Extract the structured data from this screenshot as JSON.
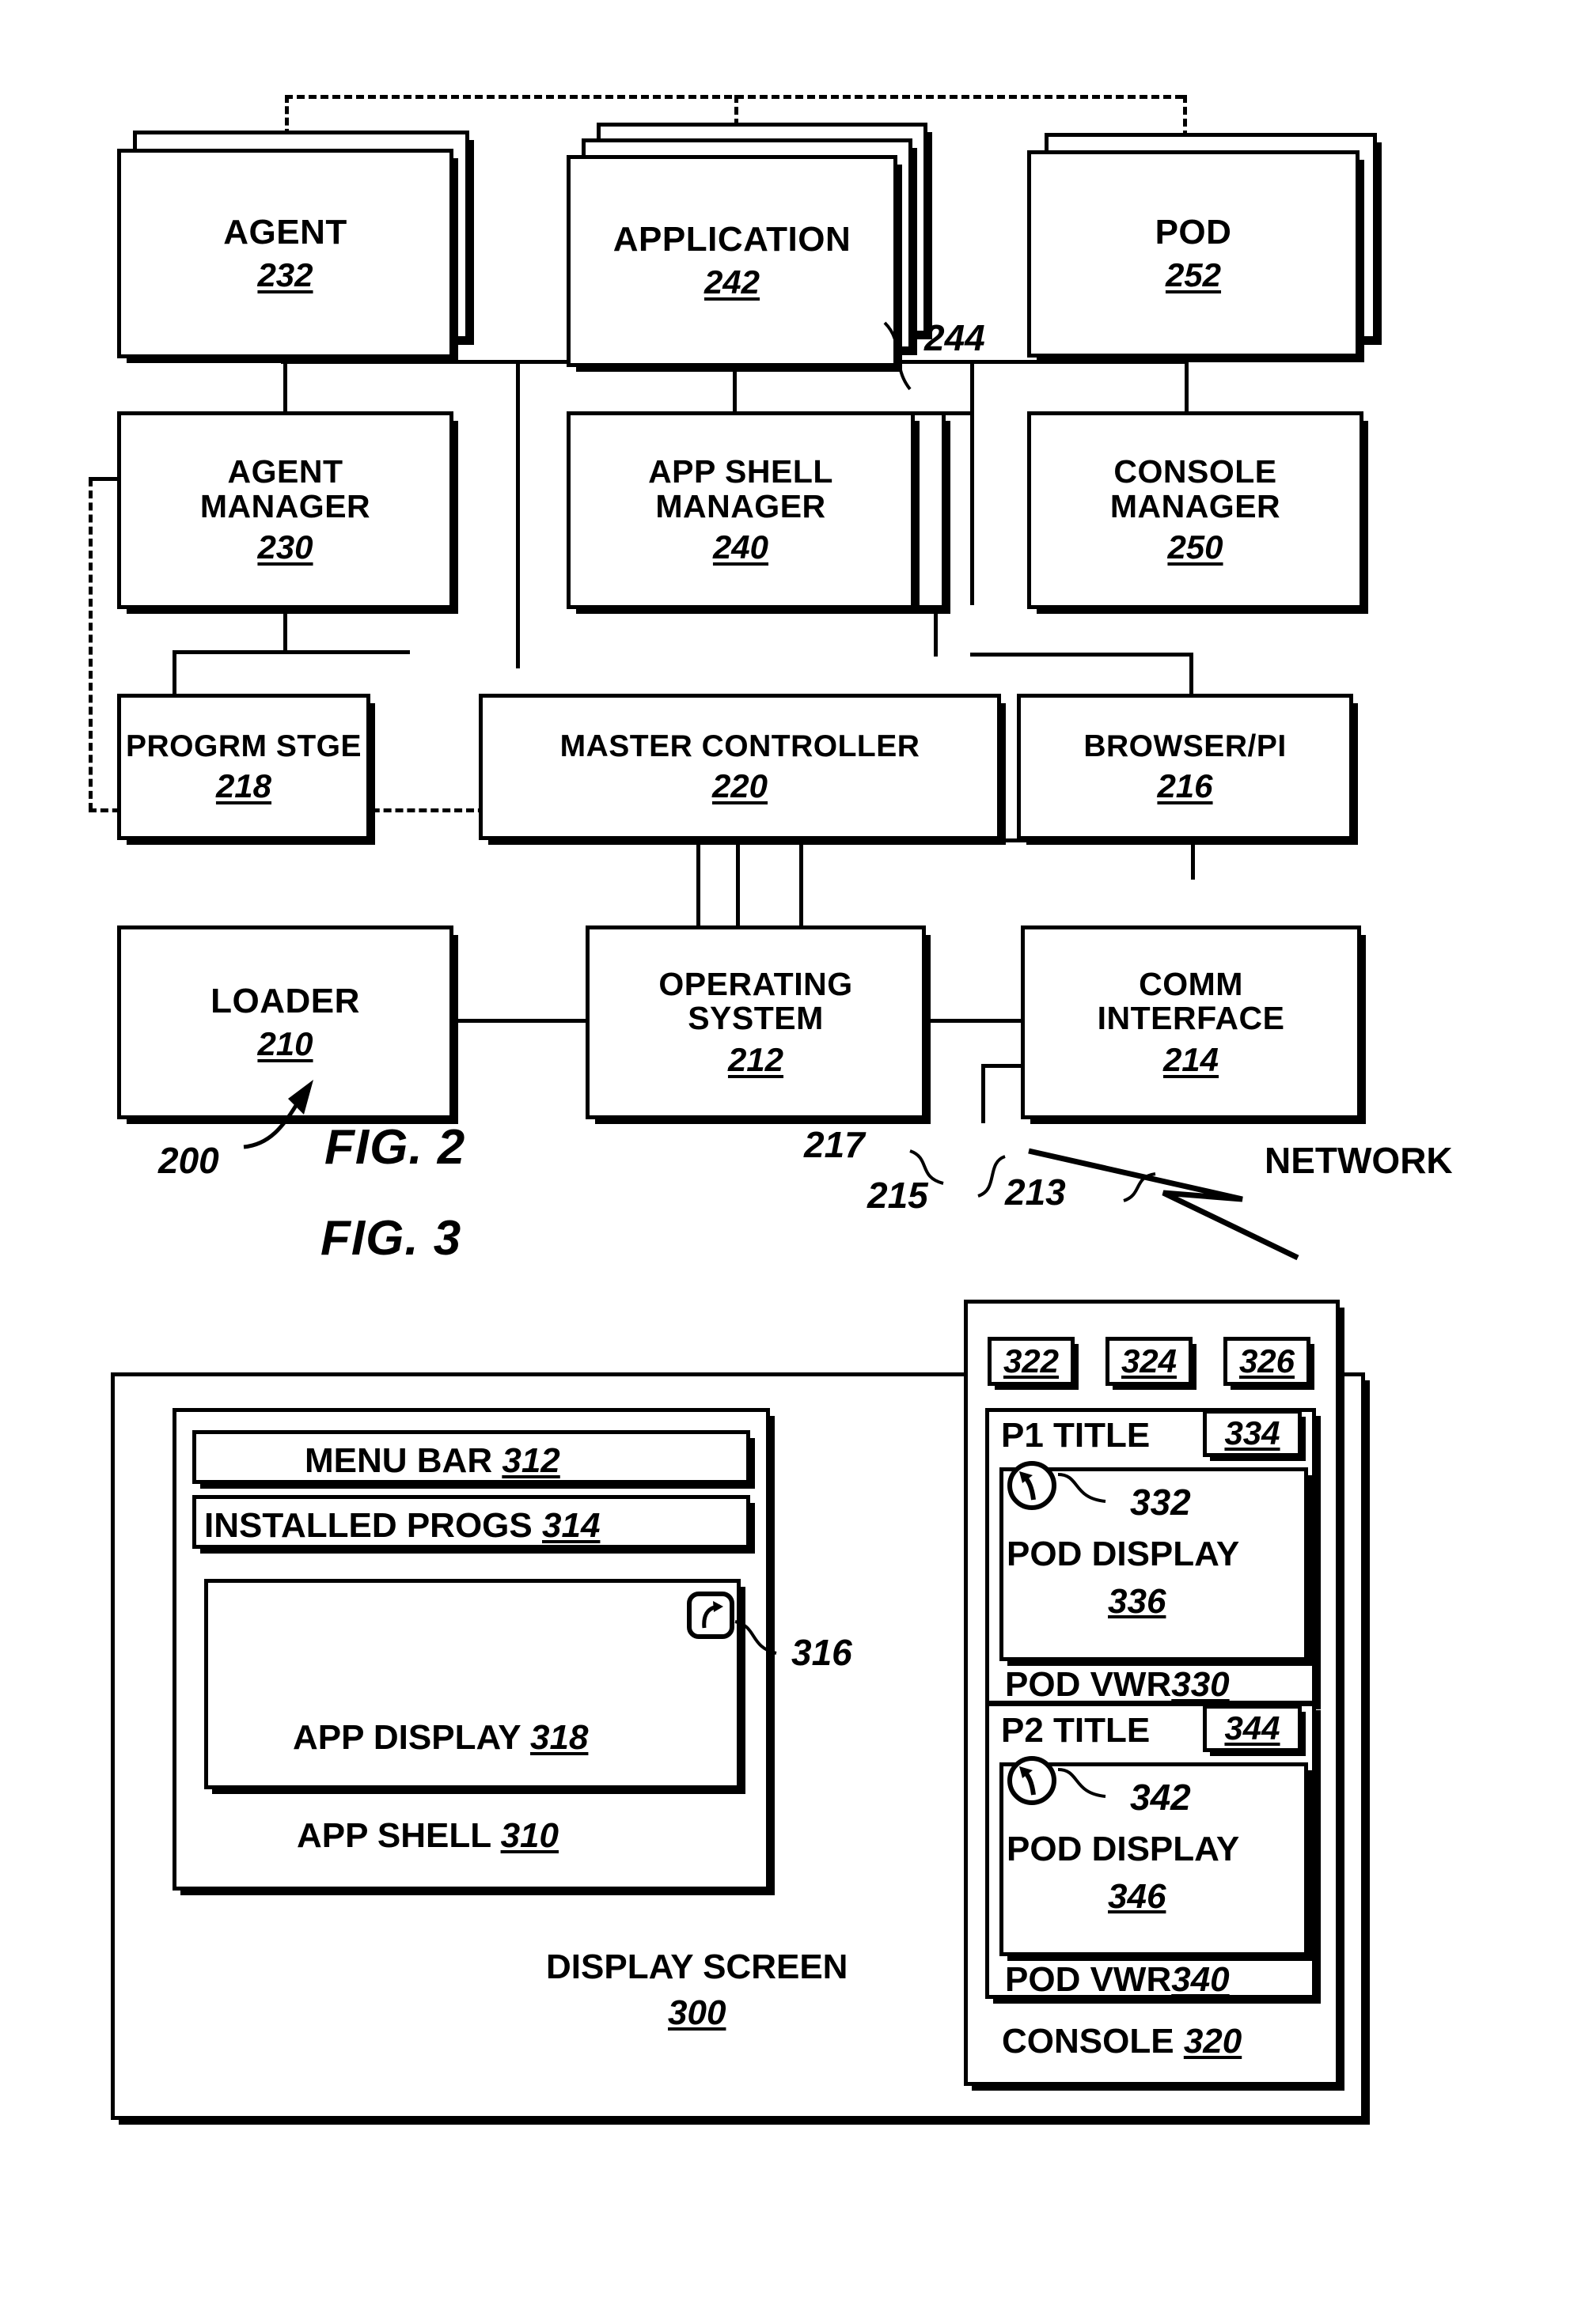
{
  "figure2": {
    "fig_label": "FIG. 2",
    "system_ref": "200",
    "network_label": "NETWORK",
    "boxes": [
      {
        "id": "agent",
        "title": "AGENT",
        "title2": "",
        "num": "232"
      },
      {
        "id": "application",
        "title": "APPLICATION",
        "title2": "",
        "num": "242"
      },
      {
        "id": "pod",
        "title": "POD",
        "title2": "",
        "num": "252"
      },
      {
        "id": "agent_manager",
        "title": "AGENT",
        "title2": "MANAGER",
        "num": "230"
      },
      {
        "id": "app_shell_manager",
        "title": "APP SHELL",
        "title2": "MANAGER",
        "num": "240"
      },
      {
        "id": "console_manager",
        "title": "CONSOLE",
        "title2": "MANAGER",
        "num": "250"
      },
      {
        "id": "progrm_stge",
        "title": "PROGRM STGE",
        "title2": "",
        "num": "218"
      },
      {
        "id": "master_controller",
        "title": "MASTER CONTROLLER",
        "title2": "",
        "num": "220"
      },
      {
        "id": "browser_pi",
        "title": "BROWSER/PI",
        "title2": "",
        "num": "216"
      },
      {
        "id": "loader",
        "title": "LOADER",
        "title2": "",
        "num": "210"
      },
      {
        "id": "operating_system",
        "title": "OPERATING",
        "title2": "SYSTEM",
        "num": "212"
      },
      {
        "id": "comm_interface",
        "title": "COMM",
        "title2": "INTERFACE",
        "num": "214"
      }
    ],
    "callouts": {
      "app_stack": "244",
      "link_217": "217",
      "link_215": "215",
      "link_213": "213"
    }
  },
  "figure3": {
    "fig_label": "FIG. 3",
    "screen_label": "DISPLAY SCREEN",
    "screen_num": "300",
    "app_shell": {
      "menu_bar_label": "MENU BAR",
      "menu_bar_num": "312",
      "installed_progs_label": "INSTALLED PROGS",
      "installed_progs_num": "314",
      "app_display_label": "APP DISPLAY",
      "app_display_num": "318",
      "shell_label": "APP SHELL",
      "shell_num": "310",
      "button_ref": "316",
      "button_icon": "curved-arrow-icon"
    },
    "console": {
      "console_label": "CONSOLE",
      "console_num": "320",
      "tabs": [
        "322",
        "324",
        "326"
      ],
      "viewers": [
        {
          "title": "P1 TITLE",
          "title_num": "334",
          "cursor_ref": "332",
          "cursor_icon": "pointer-arrow-icon",
          "display_label": "POD DISPLAY",
          "display_num": "336",
          "viewer_label": "POD VWR",
          "viewer_num": "330"
        },
        {
          "title": "P2 TITLE",
          "title_num": "344",
          "cursor_ref": "342",
          "cursor_icon": "pointer-arrow-icon",
          "display_label": "POD DISPLAY",
          "display_num": "346",
          "viewer_label": "POD VWR",
          "viewer_num": "340"
        }
      ]
    }
  }
}
